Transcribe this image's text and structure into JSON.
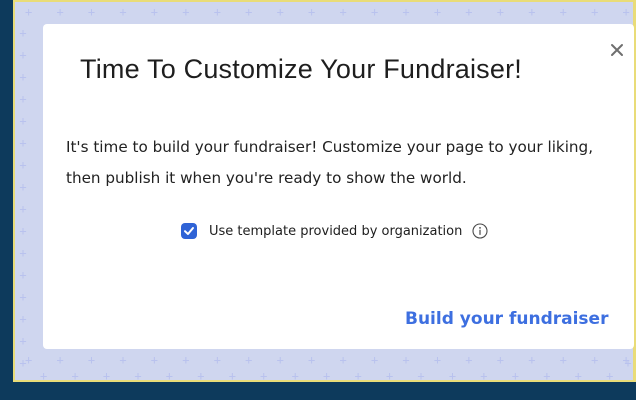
{
  "modal": {
    "title": "Time To Customize Your Fundraiser!",
    "body": "It's time to build your fundraiser! Customize your page to your liking, then publish it when you're ready to show the world.",
    "checkbox_label": "Use template provided by organization",
    "checkbox_checked": true,
    "primary_action": "Build your fundraiser"
  },
  "icons": {
    "close": "close-icon",
    "info": "info-icon",
    "check": "check-icon"
  },
  "colors": {
    "page_background": "#0d3a5c",
    "backdrop": "#fbfbf3",
    "backdrop_border": "#e9dc78",
    "pattern": "#b9c2ee",
    "accent": "#3d6fe0",
    "checkbox": "#2f63d6"
  }
}
